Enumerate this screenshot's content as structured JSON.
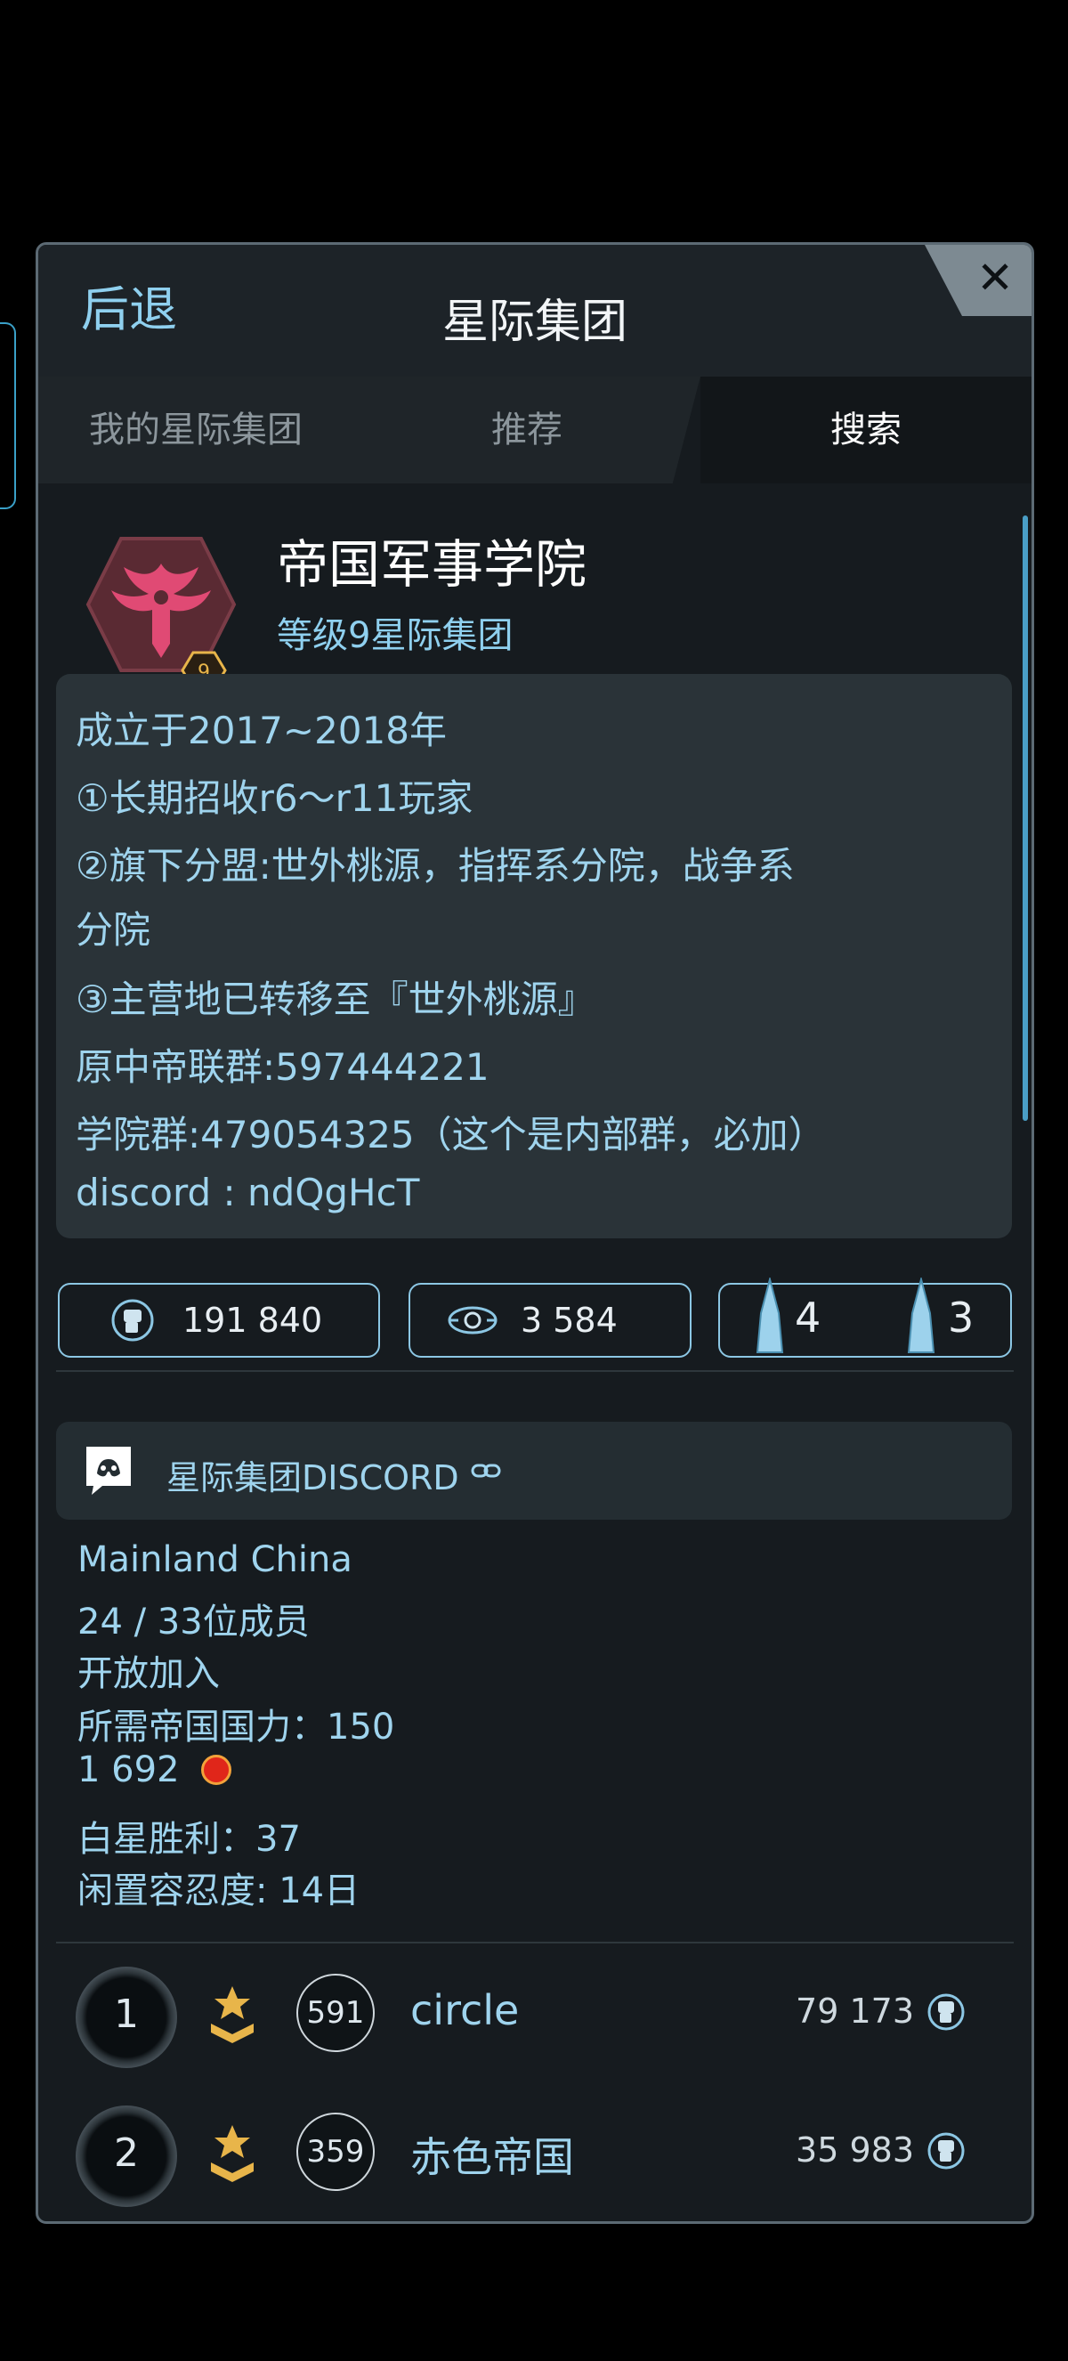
{
  "header": {
    "back_label": "后退",
    "title": "星际集团",
    "close_label": "✕"
  },
  "tabs": [
    {
      "label": "我的星际集团"
    },
    {
      "label": "推荐"
    },
    {
      "label": "搜索",
      "active": true
    }
  ],
  "alliance": {
    "name": "帝国军事学院",
    "level_text": "等级9星际集团",
    "level_badge": "9",
    "emblem_icon": "dragon-emblem-icon",
    "emblem_color": "#d2426a",
    "description_lines": [
      "成立于2017~2018年",
      "①长期招收r6～r11玩家",
      "②旗下分盟:世外桃源，指挥系分院，战争系",
      "分院",
      "③主营地已转移至『世外桃源』",
      "原中帝联群:597444221",
      "学院群:479054325（这个是内部群，必加）",
      "discord : ndQgHcT"
    ]
  },
  "stats": {
    "power": "191 840",
    "relics": "3 584",
    "ships_a": "4",
    "ships_b": "3"
  },
  "discord": {
    "label": "星际集团DISCORD",
    "icon": "discord-icon",
    "link_icon": "link-icon"
  },
  "info": {
    "region": "Mainland China",
    "members": "24 / 33位成员",
    "join_policy": "开放加入",
    "required_power": "所需帝国国力：150",
    "red_stars": "1 692",
    "white_star_wins": "白星胜利：37",
    "idle_tolerance": "闲置容忍度: 14日"
  },
  "members": [
    {
      "rank": "1",
      "level": "591",
      "name": "circle",
      "power": "79 173"
    },
    {
      "rank": "2",
      "level": "359",
      "name": "赤色帝国",
      "power": "35 983"
    }
  ],
  "colors": {
    "accent": "#8fd0ef",
    "panel_bg": "#161b1f",
    "card_bg": "#2a3338",
    "badge_gold": "#e8b54a",
    "red_star": "#e0261a"
  }
}
